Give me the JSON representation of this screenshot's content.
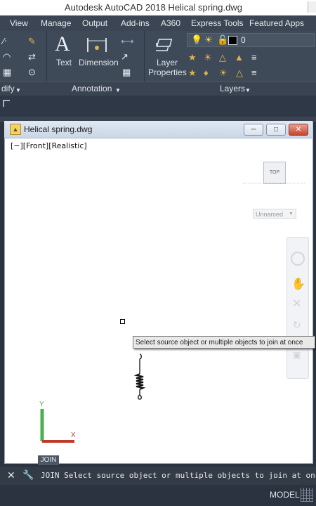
{
  "app": {
    "window_title": "Autodesk AutoCAD 2018    Helical spring.dwg"
  },
  "ribbon": {
    "tabs": [
      "View",
      "Manage",
      "Output",
      "Add-ins",
      "A360",
      "Express Tools",
      "Featured Apps"
    ],
    "buttons": {
      "text": "Text",
      "dimension": "Dimension",
      "layer_properties_line1": "Layer",
      "layer_properties_line2": "Properties"
    },
    "layer_value": "0",
    "panels": {
      "modify": "dify",
      "annotation": "Annotation",
      "layers": "Layers"
    }
  },
  "drawing_window": {
    "title": "Helical spring.dwg",
    "viewport_controls": "[−][Front][Realistic]",
    "viewcube_face": "TOP",
    "ucs_name": "Unnamed",
    "tooltip": "Select source object or multiple objects to join at once"
  },
  "command": {
    "badge": "JOIN",
    "prompt": "JOIN Select source object or multiple objects to join at once"
  },
  "status": {
    "model": "MODEL"
  },
  "colors": {
    "ribbon_bg": "#3f4a59",
    "drawing_bg": "#ffffff",
    "ucs_y": "#4caf50",
    "ucs_x": "#c0392b"
  },
  "icons": [
    "line-icon",
    "arc-icon",
    "array-icon",
    "pen-icon",
    "text-icon",
    "dimension-icon",
    "leader-icon",
    "table-icon",
    "layer-properties-icon",
    "lightbulb-icon",
    "sun-icon",
    "lock-icon",
    "color-swatch-icon",
    "close-icon",
    "wrench-icon",
    "grid-icon"
  ]
}
